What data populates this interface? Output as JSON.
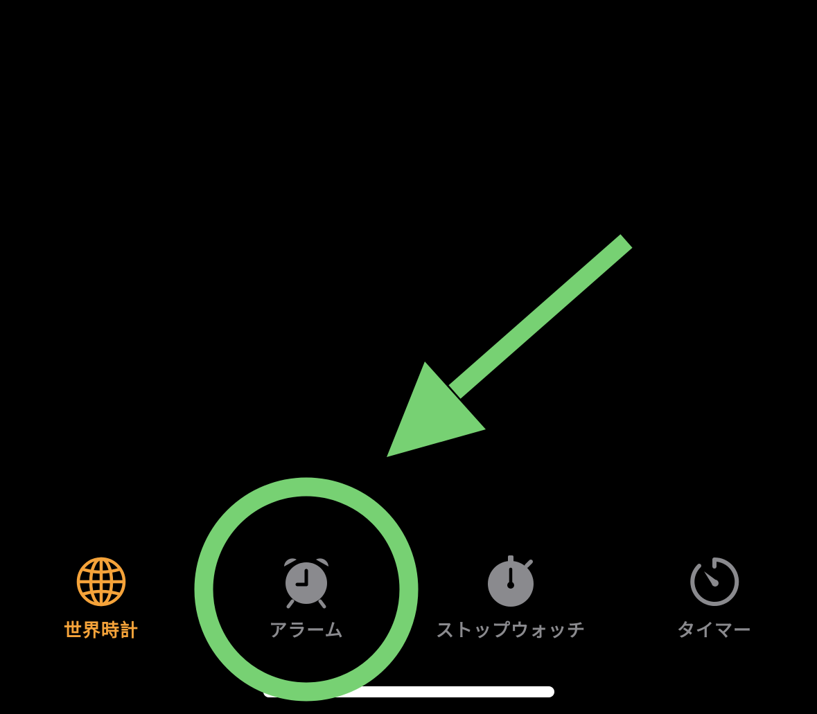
{
  "colors": {
    "background": "#000000",
    "active_tab": "#F5A33A",
    "inactive_tab": "#8A8A8E",
    "annotation": "#77D173",
    "home_indicator": "#FFFFFF"
  },
  "tab_bar": {
    "tabs": [
      {
        "id": "world-clock",
        "label": "世界時計",
        "icon": "globe-icon",
        "active": true
      },
      {
        "id": "alarm",
        "label": "アラーム",
        "icon": "alarm-clock-icon",
        "active": false
      },
      {
        "id": "stopwatch",
        "label": "ストップウォッチ",
        "icon": "stopwatch-icon",
        "active": false
      },
      {
        "id": "timer",
        "label": "タイマー",
        "icon": "timer-icon",
        "active": false
      }
    ]
  },
  "annotation": {
    "highlight": "green-circle",
    "pointer": "green-arrow",
    "target": "alarm"
  }
}
